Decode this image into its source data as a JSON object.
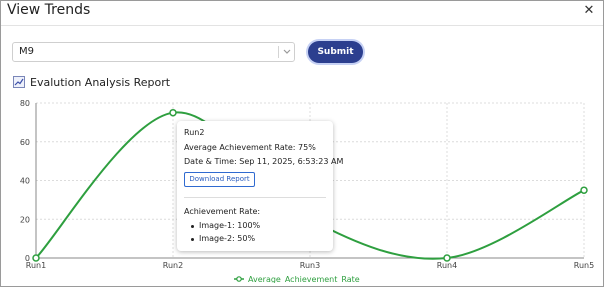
{
  "window": {
    "title": "View Trends"
  },
  "toolbar": {
    "select_value": "M9",
    "submit_label": "Submit"
  },
  "report": {
    "title": "Evalution Analysis Report"
  },
  "colors": {
    "series": "#2e9f3f",
    "submit_bg": "#2c3f8f",
    "grid": "#dcdcdc"
  },
  "icons": {
    "close": "close-icon",
    "dropdown": "chevron-down-icon",
    "report": "line-chart-icon"
  },
  "chart_data": {
    "type": "line",
    "categories": [
      "Run1",
      "Run2",
      "Run3",
      "Run4",
      "Run5"
    ],
    "series": [
      {
        "name": "Average_Achievement_Rate",
        "values": [
          0,
          75,
          20,
          0,
          35
        ]
      }
    ],
    "yticks": [
      "0",
      "20",
      "40",
      "60",
      "80"
    ],
    "ylim": [
      0,
      80
    ],
    "grid": true,
    "legend": "bottom"
  },
  "tooltip": {
    "title": "Run2",
    "avg_rate": "Average Achievement Rate: 75%",
    "datetime": "Date & Time: Sep 11, 2025, 6:53:23 AM",
    "download_label": "Download Report",
    "section_label": "Achievement Rate:",
    "items": [
      "Image-1: 100%",
      "Image-2: 50%"
    ]
  }
}
